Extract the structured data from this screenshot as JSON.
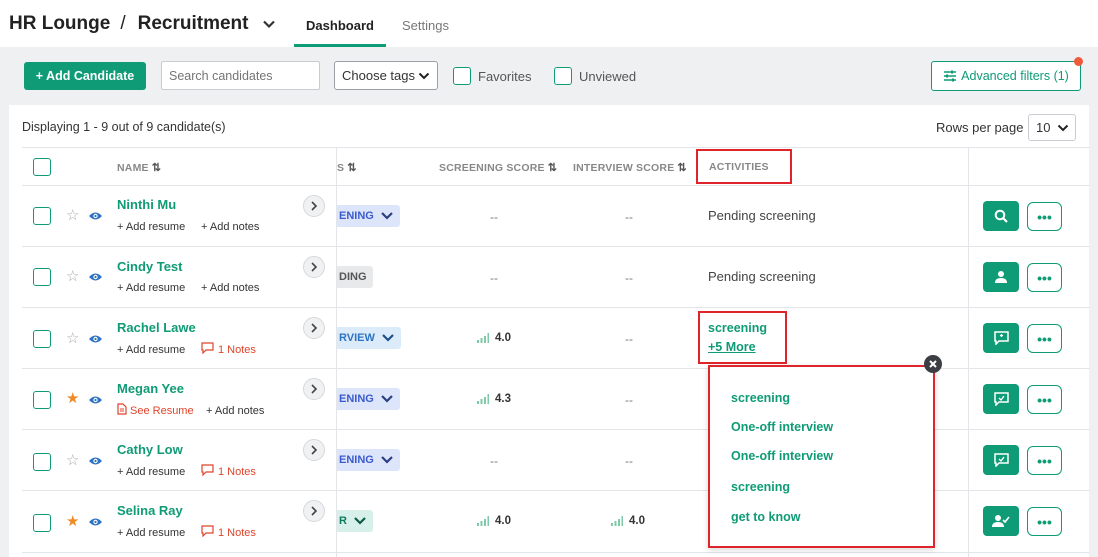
{
  "header": {
    "org": "HR Lounge",
    "separator": "/",
    "module": "Recruitment",
    "tabs": [
      {
        "label": "Dashboard",
        "active": true
      },
      {
        "label": "Settings",
        "active": false
      }
    ]
  },
  "toolbar": {
    "add_label": "+ Add Candidate",
    "search_placeholder": "Search candidates",
    "tags_label": "Choose tags",
    "favorites_label": "Favorites",
    "unviewed_label": "Unviewed",
    "advanced_label": "Advanced filters (1)"
  },
  "list": {
    "displaying": "Displaying 1 - 9 out of 9 candidate(s)",
    "rows_per_page_label": "Rows per page",
    "rows_per_page": "10"
  },
  "columns": {
    "name": "NAME",
    "status": "S",
    "screening": "SCREENING SCORE",
    "interview": "INTERVIEW SCORE",
    "activities": "ACTIVITIES"
  },
  "rows": [
    {
      "name": "Ninthi Mu",
      "starred": false,
      "sub1": "+ Add resume",
      "sub2": "+ Add notes",
      "status": "ENING",
      "screening": "--",
      "interview": "--",
      "activity": "Pending screening",
      "action_icon": "search-icon"
    },
    {
      "name": "Cindy Test",
      "starred": false,
      "sub1": "+ Add resume",
      "sub2": "+ Add notes",
      "status": "DING",
      "screening": "--",
      "interview": "--",
      "activity": "Pending screening",
      "action_icon": "user-icon"
    },
    {
      "name": "Rachel Lawe",
      "starred": false,
      "sub1": "+ Add resume",
      "sub2": "1 Notes",
      "status": "RVIEW",
      "screening": "4.0",
      "interview": "--",
      "activity": "screening",
      "more": "+5 More",
      "action_icon": "feedback-icon"
    },
    {
      "name": "Megan Yee",
      "starred": true,
      "sub1": "See Resume",
      "sub2": "+ Add notes",
      "status": "ENING",
      "screening": "4.3",
      "interview": "--",
      "activity": "",
      "action_icon": "feedback-icon"
    },
    {
      "name": "Cathy Low",
      "starred": false,
      "sub1": "+ Add resume",
      "sub2": "1 Notes",
      "status": "ENING",
      "screening": "--",
      "interview": "--",
      "activity": "",
      "action_icon": "feedback-icon"
    },
    {
      "name": "Selina Ray",
      "starred": true,
      "sub1": "+ Add resume",
      "sub2": "1 Notes",
      "status": "R",
      "screening": "4.0",
      "interview": "4.0",
      "activity": "",
      "action_icon": "user-check-icon"
    }
  ],
  "dots_label": "•••",
  "popup": {
    "items": [
      "screening",
      "One-off interview",
      "One-off interview",
      "screening",
      "get to know"
    ]
  },
  "colors": {
    "accent": "#0f9b76",
    "highlight": "#e0242b",
    "star": "#f08a24"
  }
}
